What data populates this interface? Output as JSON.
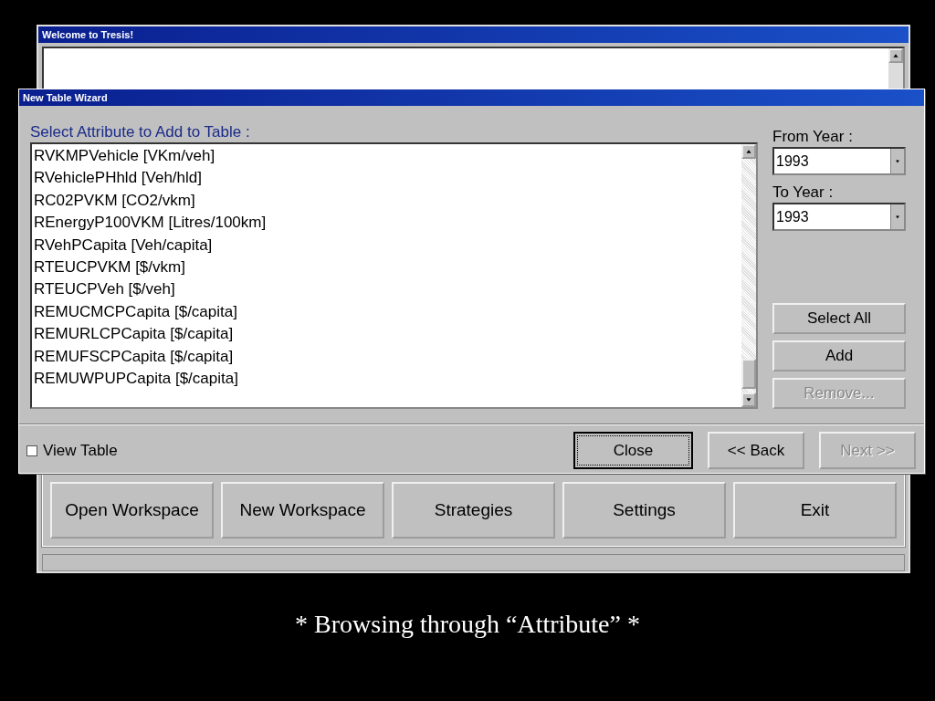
{
  "background_window": {
    "title": "Welcome to Tresis!",
    "buttons": [
      {
        "label": "Open Workspace"
      },
      {
        "label": "New Workspace"
      },
      {
        "label": "Strategies"
      },
      {
        "label": "Settings"
      },
      {
        "label": "Exit"
      }
    ]
  },
  "wizard": {
    "title": "New Table Wizard",
    "list_label": "Select Attribute to Add to Table :",
    "attributes": [
      {
        "label": "RVKMPVehicle [VKm/veh]",
        "selected": false
      },
      {
        "label": "RVehiclePHhld [Veh/hld]",
        "selected": false
      },
      {
        "label": "RC02PVKM [CO2/vkm]",
        "selected": false
      },
      {
        "label": "REnergyP100VKM [Litres/100km]",
        "selected": false
      },
      {
        "label": "RVehPCapita [Veh/capita]",
        "selected": false
      },
      {
        "label": "RTEUCPVKM [$/vkm]",
        "selected": false
      },
      {
        "label": "RTEUCPVeh [$/veh]",
        "selected": false
      },
      {
        "label": "REMUCMCPCapita [$/capita]",
        "selected": false
      },
      {
        "label": "REMURLCPCapita [$/capita]",
        "selected": false
      },
      {
        "label": "REMUFSCPCapita [$/capita]",
        "selected": false
      },
      {
        "label": "REMUWPUPCapita [$/capita]",
        "selected": false
      }
    ],
    "from_year": {
      "label": "From Year :",
      "value": "1993"
    },
    "to_year": {
      "label": "To Year :",
      "value": "1993"
    },
    "side_buttons": [
      {
        "label": "Select All",
        "disabled": false
      },
      {
        "label": "Add",
        "disabled": false
      },
      {
        "label": "Remove...",
        "disabled": true
      }
    ],
    "view_table": {
      "label": "View Table",
      "checked": false
    },
    "nav_buttons": [
      {
        "label": "Close",
        "disabled": false,
        "default": true
      },
      {
        "label": "<< Back",
        "disabled": false,
        "default": false
      },
      {
        "label": "Next >>",
        "disabled": true,
        "default": false
      }
    ]
  },
  "caption": "* Browsing through “Attribute” *"
}
